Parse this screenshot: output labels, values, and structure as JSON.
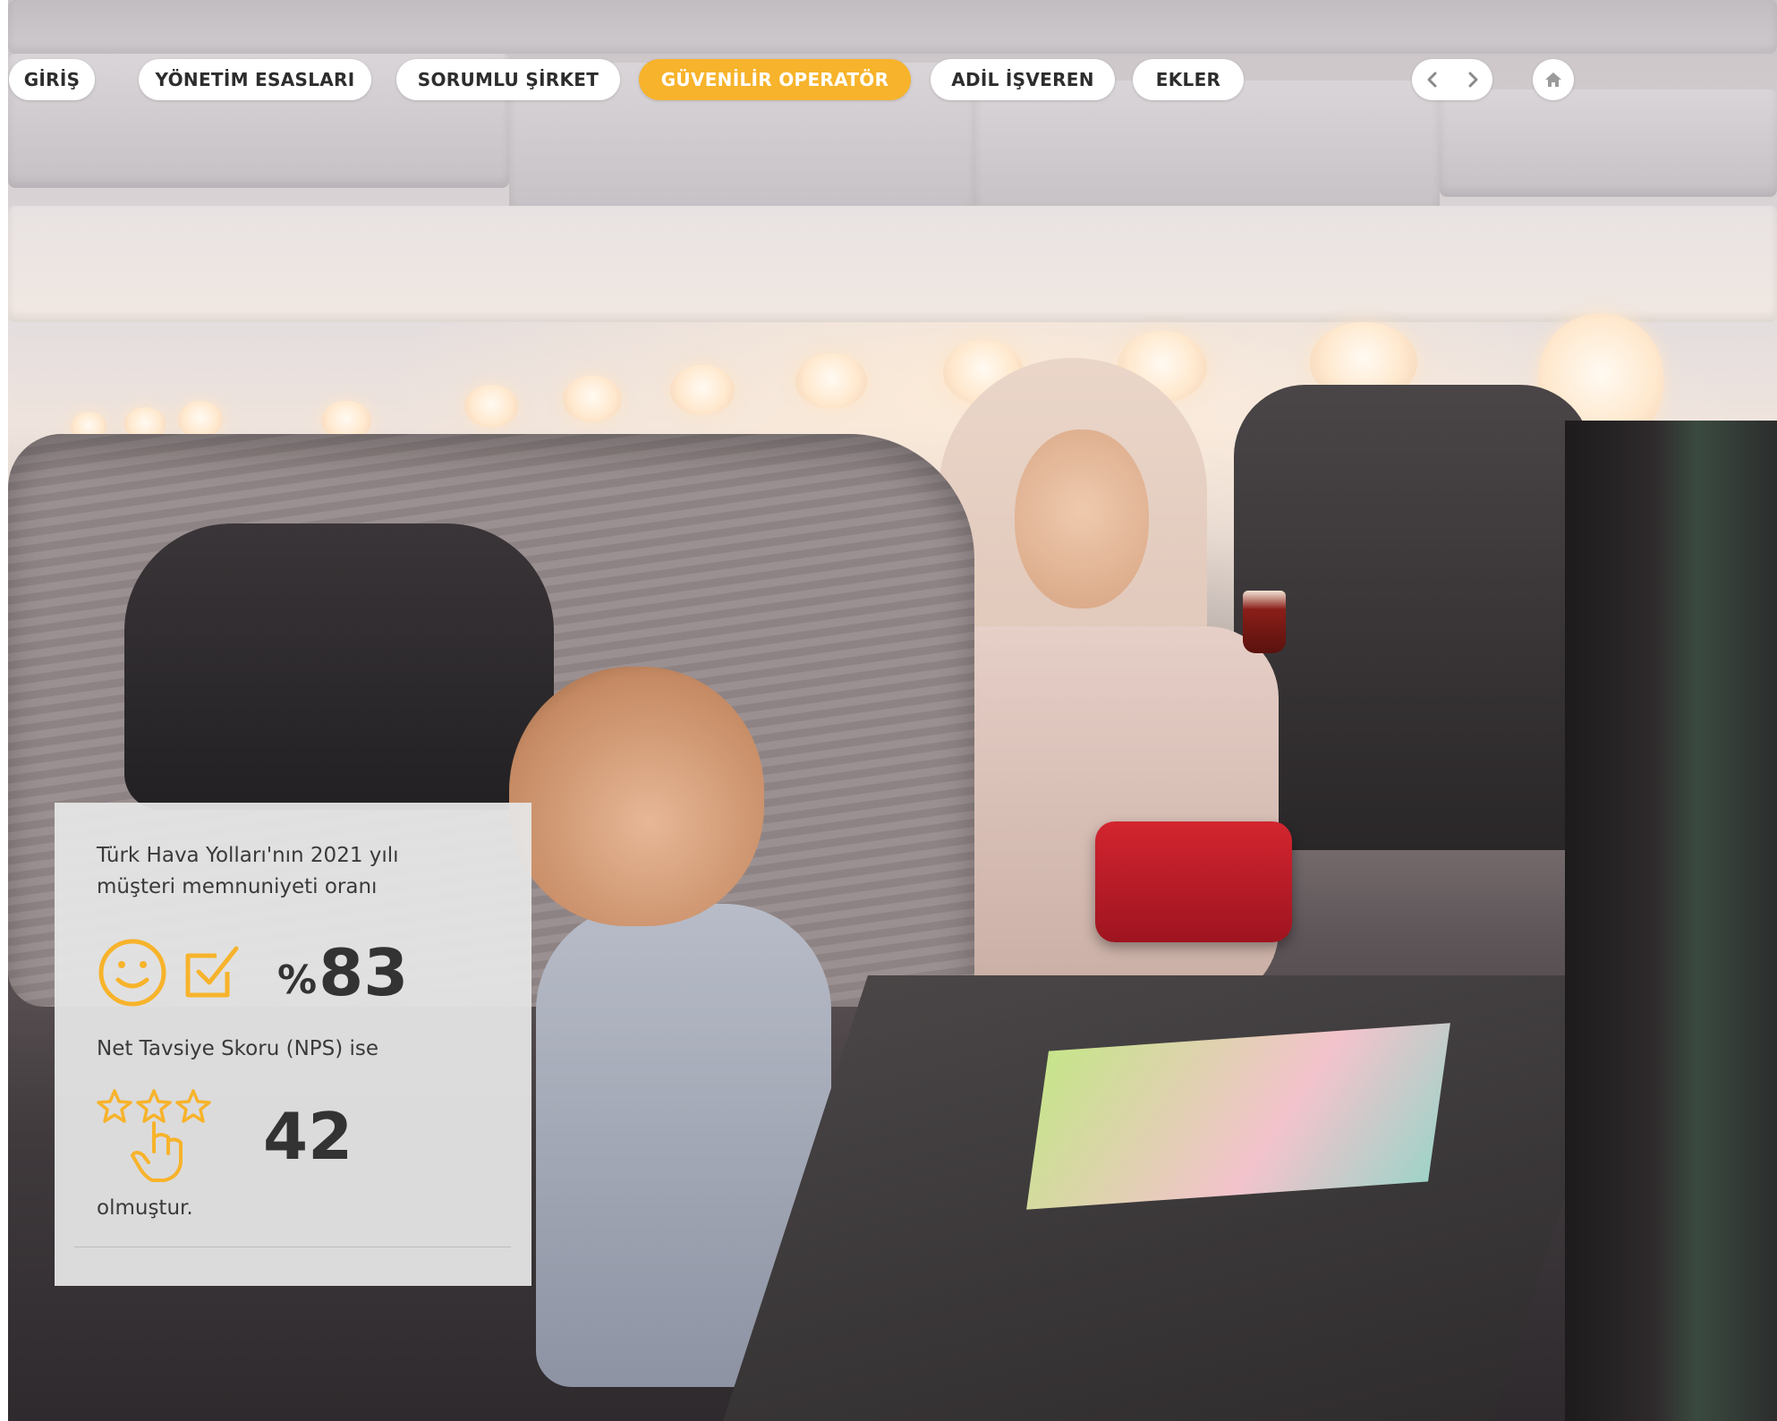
{
  "nav": {
    "items": [
      {
        "label": "GİRİŞ",
        "active": false
      },
      {
        "label": "YÖNETİM ESASLARI",
        "active": false
      },
      {
        "label": "SORUMLU ŞİRKET",
        "active": false
      },
      {
        "label": "GÜVENİLİR OPERATÖR",
        "active": true
      },
      {
        "label": "ADİL İŞVEREN",
        "active": false
      },
      {
        "label": "EKLER",
        "active": false
      }
    ],
    "prev_icon": "chevron-left-icon",
    "next_icon": "chevron-right-icon",
    "home_icon": "home-icon"
  },
  "stats_card": {
    "intro_line1": "Türk Hava Yolları'nın 2021 yılı",
    "intro_line2": "müşteri memnuniyeti oranı",
    "satisfaction": {
      "prefix": "%",
      "value": "83",
      "icons": [
        "smiley-icon",
        "checkbox-icon"
      ]
    },
    "nps_label": "Net Tavsiye Skoru (NPS) ise",
    "nps": {
      "value": "42",
      "icons": [
        "stars-rating-icon"
      ]
    },
    "closing": "olmuştur."
  },
  "colors": {
    "accent": "#F7B32B",
    "nav_text": "#2D2D2D",
    "card_bg": "#E6E6E6",
    "stat_text": "#333333"
  },
  "background": {
    "description_icon": "airplane-cabin-photo"
  }
}
